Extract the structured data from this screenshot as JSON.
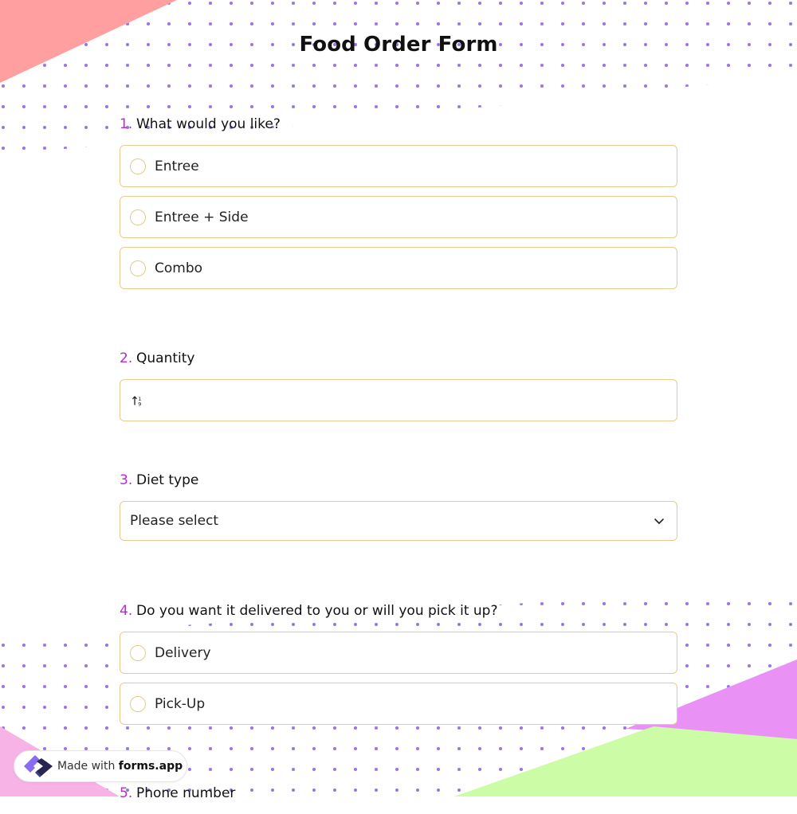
{
  "form": {
    "title": "Food Order Form"
  },
  "colors": {
    "accent_number": "#b32ad1",
    "border": "#eac98a",
    "corner_top_left": "#ff9f9f",
    "corner_bottom_right_purple": "#e991f5",
    "corner_bottom_right_green": "#cdfca6",
    "dots": "#8a5be0"
  },
  "questions": [
    {
      "number": "1.",
      "label": "What would you like?",
      "type": "radio",
      "options": [
        "Entree",
        "Entree + Side",
        "Combo"
      ]
    },
    {
      "number": "2.",
      "label": "Quantity",
      "type": "number",
      "value": "",
      "icon": "sort-numeric-icon"
    },
    {
      "number": "3.",
      "label": "Diet type",
      "type": "select",
      "selected": "Please select",
      "icon": "chevron-down-icon"
    },
    {
      "number": "4.",
      "label": "Do you want it delivered to you or will you pick it up?",
      "type": "radio",
      "options": [
        "Delivery",
        "Pick-Up"
      ]
    },
    {
      "number": "5.",
      "label": "Phone number",
      "type": "text"
    }
  ],
  "badge": {
    "prefix": "Made with",
    "brand": "forms.app"
  }
}
